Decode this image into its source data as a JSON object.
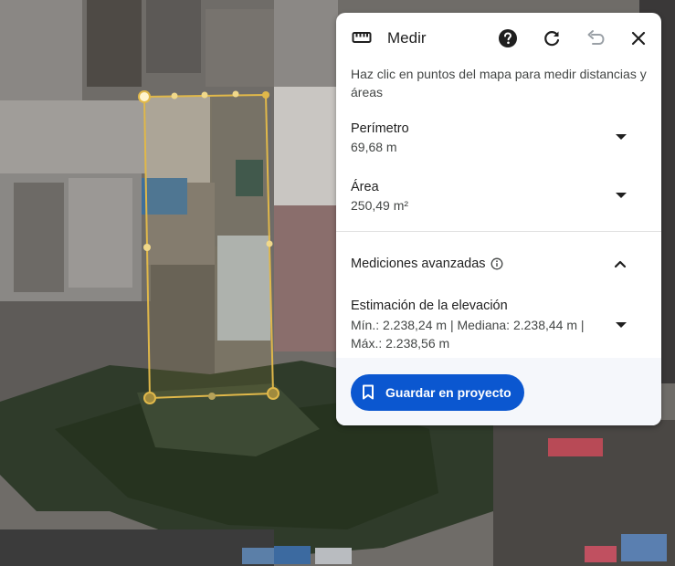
{
  "panel": {
    "title": "Medir",
    "hint": "Haz clic en puntos del mapa para medir distancias y áreas",
    "perimeter": {
      "label": "Perímetro",
      "value": "69,68 m"
    },
    "area": {
      "label": "Área",
      "value": "250,49 m²"
    },
    "advanced": {
      "label": "Mediciones avanzadas"
    },
    "elevation": {
      "label": "Estimación de la elevación",
      "value": "Mín.: 2.238,24 m | Mediana: 2.238,44 m | Máx.: 2.238,56 m"
    },
    "save_label": "Guardar en proyecto"
  },
  "icons": {
    "ruler": "ruler-icon",
    "help": "help-icon",
    "refresh": "refresh-icon",
    "undo": "undo-icon",
    "close": "close-icon",
    "info": "info-icon",
    "bookmark": "bookmark-icon"
  },
  "colors": {
    "accent": "#0b57d0",
    "measure_outline": "#e0b84a"
  }
}
